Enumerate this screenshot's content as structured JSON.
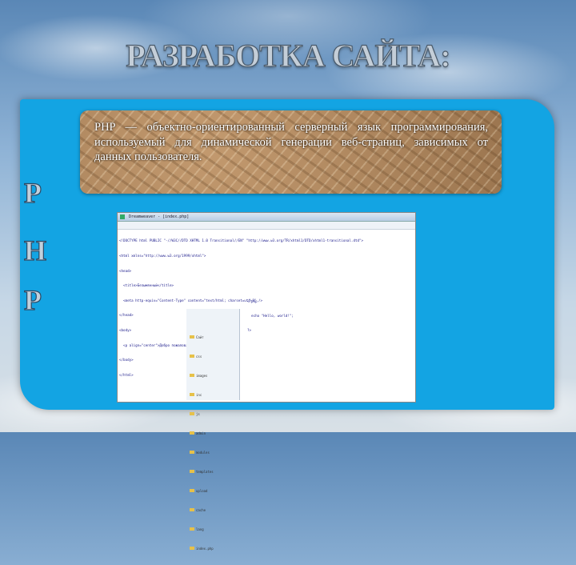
{
  "slide": {
    "title": "РАЗРАБОТКА САЙТА:",
    "side_letters": [
      "P",
      "H",
      "P"
    ],
    "paragraph": "PHP — объектно-ориентированный серверный язык программирования, используемый для динамической генерации веб-страниц, зависимых от данных пользователя."
  },
  "screenshot": {
    "window_title": "Dreamweaver - [index.php]",
    "code_lines": [
      "<!DOCTYPE html PUBLIC \"-//W3C//DTD XHTML 1.0 Transitional//EN\" \"http://www.w3.org/TR/xhtml1/DTD/xhtml1-transitional.dtd\">",
      "<html xmlns=\"http://www.w3.org/1999/xhtml\">",
      "<head>",
      "  <title>Безымянный</title>",
      "  <meta http-equiv=\"Content-Type\" content=\"text/html; charset=utf-8\" />",
      "</head>",
      "<body>",
      "  <p align=\"center\">Добро пожаловать!</p>",
      "</body>",
      "</html>"
    ],
    "code_lines2": [
      "<?php",
      "  echo \"Hello, world!\";",
      "?>"
    ],
    "tree_items": [
      "Сайт",
      "css",
      "images",
      "inc",
      "js",
      "admin",
      "modules",
      "templates",
      "upload",
      "cache",
      "lang",
      "index.php"
    ]
  },
  "colors": {
    "panel": "#13a4e3",
    "title": "#c4ced8"
  }
}
